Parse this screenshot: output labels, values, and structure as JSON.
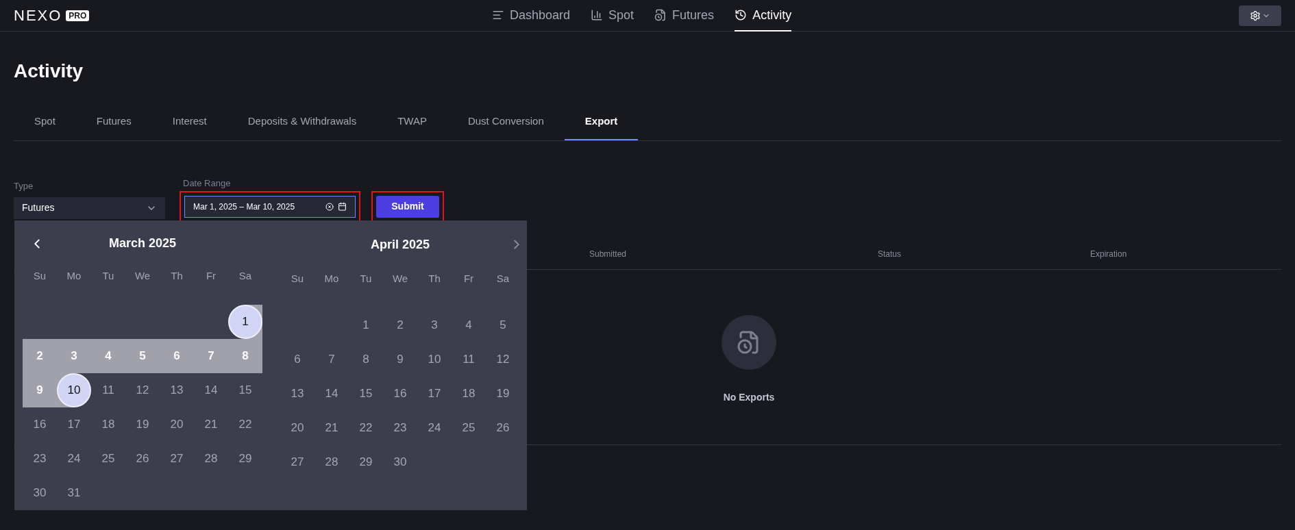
{
  "header": {
    "logo": "NEXO",
    "logo_badge": "PRO",
    "nav": [
      {
        "label": "Dashboard",
        "selected": false
      },
      {
        "label": "Spot",
        "selected": false
      },
      {
        "label": "Futures",
        "selected": false
      },
      {
        "label": "Activity",
        "selected": true
      }
    ]
  },
  "page_title": "Activity",
  "tabs": [
    {
      "label": "Spot",
      "selected": false
    },
    {
      "label": "Futures",
      "selected": false
    },
    {
      "label": "Interest",
      "selected": false
    },
    {
      "label": "Deposits & Withdrawals",
      "selected": false
    },
    {
      "label": "TWAP",
      "selected": false
    },
    {
      "label": "Dust Conversion",
      "selected": false
    },
    {
      "label": "Export",
      "selected": true
    }
  ],
  "filters": {
    "type": {
      "label": "Type",
      "value": "Futures"
    },
    "date_range": {
      "label": "Date Range",
      "value": "Mar 1, 2025 – Mar 10, 2025",
      "focused": true,
      "highlighted": true
    },
    "submit": {
      "label": "Submit",
      "highlighted": true
    }
  },
  "calendar": {
    "months": [
      {
        "title": "March 2025",
        "weekdays": [
          "Su",
          "Mo",
          "Tu",
          "We",
          "Th",
          "Fr",
          "Sa"
        ],
        "weeks": [
          [
            {
              "kind": "blank"
            },
            {
              "kind": "blank"
            },
            {
              "kind": "blank"
            },
            {
              "kind": "blank"
            },
            {
              "kind": "blank"
            },
            {
              "kind": "blank"
            },
            {
              "label": "1",
              "kind": "start"
            }
          ],
          [
            {
              "label": "2",
              "kind": "in"
            },
            {
              "label": "3",
              "kind": "in"
            },
            {
              "label": "4",
              "kind": "in"
            },
            {
              "label": "5",
              "kind": "in"
            },
            {
              "label": "6",
              "kind": "in"
            },
            {
              "label": "7",
              "kind": "in"
            },
            {
              "label": "8",
              "kind": "in"
            }
          ],
          [
            {
              "label": "9",
              "kind": "in"
            },
            {
              "label": "10",
              "kind": "end"
            },
            {
              "label": "11",
              "kind": "day"
            },
            {
              "label": "12",
              "kind": "day"
            },
            {
              "label": "13",
              "kind": "day"
            },
            {
              "label": "14",
              "kind": "day"
            },
            {
              "label": "15",
              "kind": "day"
            }
          ],
          [
            {
              "label": "16",
              "kind": "day"
            },
            {
              "label": "17",
              "kind": "day"
            },
            {
              "label": "18",
              "kind": "day"
            },
            {
              "label": "19",
              "kind": "day"
            },
            {
              "label": "20",
              "kind": "day"
            },
            {
              "label": "21",
              "kind": "day"
            },
            {
              "label": "22",
              "kind": "day"
            }
          ],
          [
            {
              "label": "23",
              "kind": "day"
            },
            {
              "label": "24",
              "kind": "day"
            },
            {
              "label": "25",
              "kind": "day"
            },
            {
              "label": "26",
              "kind": "day"
            },
            {
              "label": "27",
              "kind": "day"
            },
            {
              "label": "28",
              "kind": "day"
            },
            {
              "label": "29",
              "kind": "day"
            }
          ],
          [
            {
              "label": "30",
              "kind": "day"
            },
            {
              "label": "31",
              "kind": "day"
            }
          ]
        ]
      },
      {
        "title": "April 2025",
        "weekdays": [
          "Su",
          "Mo",
          "Tu",
          "We",
          "Th",
          "Fr",
          "Sa"
        ],
        "weeks": [
          [
            {
              "kind": "blank"
            },
            {
              "kind": "blank"
            },
            {
              "label": "1",
              "kind": "day"
            },
            {
              "label": "2",
              "kind": "day"
            },
            {
              "label": "3",
              "kind": "day"
            },
            {
              "label": "4",
              "kind": "day"
            },
            {
              "label": "5",
              "kind": "day"
            }
          ],
          [
            {
              "label": "6",
              "kind": "day"
            },
            {
              "label": "7",
              "kind": "day"
            },
            {
              "label": "8",
              "kind": "day"
            },
            {
              "label": "9",
              "kind": "day"
            },
            {
              "label": "10",
              "kind": "day"
            },
            {
              "label": "11",
              "kind": "day"
            },
            {
              "label": "12",
              "kind": "day"
            }
          ],
          [
            {
              "label": "13",
              "kind": "day"
            },
            {
              "label": "14",
              "kind": "day"
            },
            {
              "label": "15",
              "kind": "day"
            },
            {
              "label": "16",
              "kind": "day"
            },
            {
              "label": "17",
              "kind": "day"
            },
            {
              "label": "18",
              "kind": "day"
            },
            {
              "label": "19",
              "kind": "day"
            }
          ],
          [
            {
              "label": "20",
              "kind": "day"
            },
            {
              "label": "21",
              "kind": "day"
            },
            {
              "label": "22",
              "kind": "day"
            },
            {
              "label": "23",
              "kind": "day"
            },
            {
              "label": "24",
              "kind": "day"
            },
            {
              "label": "25",
              "kind": "day"
            },
            {
              "label": "26",
              "kind": "day"
            }
          ],
          [
            {
              "label": "27",
              "kind": "day"
            },
            {
              "label": "28",
              "kind": "day"
            },
            {
              "label": "29",
              "kind": "day"
            },
            {
              "label": "30",
              "kind": "day"
            }
          ]
        ]
      }
    ]
  },
  "table": {
    "columns": [
      "Submitted",
      "Status",
      "Expiration"
    ],
    "empty_text": "No Exports"
  }
}
